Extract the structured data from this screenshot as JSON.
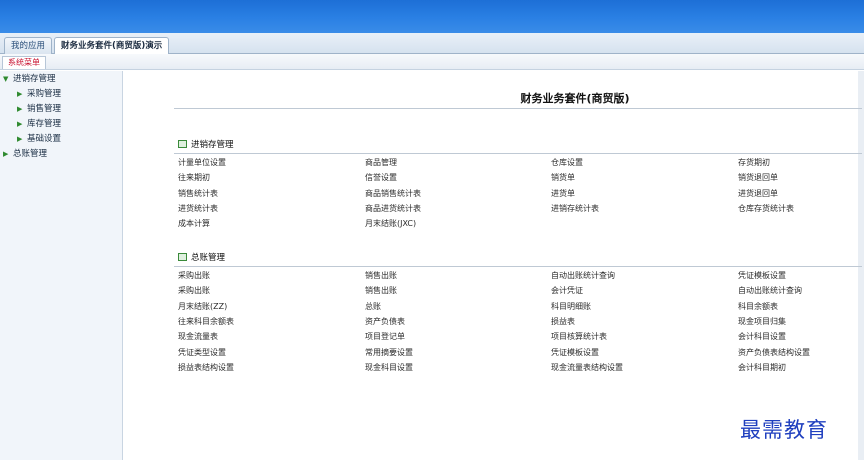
{
  "tabs": [
    {
      "label": "我的应用"
    },
    {
      "label": "财务业务套件(商贸版)演示"
    }
  ],
  "subtab": "系统菜单",
  "sidebar": {
    "items": [
      {
        "label": "进销存管理"
      },
      {
        "label": "采购管理"
      },
      {
        "label": "销售管理"
      },
      {
        "label": "库存管理"
      },
      {
        "label": "基础设置"
      },
      {
        "label": "总账管理"
      }
    ]
  },
  "main": {
    "title": "财务业务套件(商贸版)",
    "sections": [
      {
        "heading": "进销存管理",
        "rows": [
          [
            "计量单位设置",
            "商品管理",
            "仓库设置",
            "存货期初"
          ],
          [
            "往来期初",
            "信誉设置",
            "销货单",
            "销货退回单"
          ],
          [
            "销售统计表",
            "商品销售统计表",
            "进货单",
            "进货退回单"
          ],
          [
            "进货统计表",
            "商品进货统计表",
            "进销存统计表",
            "仓库存货统计表"
          ],
          [
            "成本计算",
            "月末结账(JXC)",
            "",
            ""
          ]
        ]
      },
      {
        "heading": "总账管理",
        "rows": [
          [
            "采购出账",
            "销售出账",
            "自动出账统计查询",
            "凭证模板设置"
          ],
          [
            "采购出账",
            "销售出账",
            "会计凭证",
            "自动出账统计查询"
          ],
          [
            "月末结账(ZZ)",
            "总账",
            "科目明细账",
            "科目余额表"
          ],
          [
            "往来科目余额表",
            "资产负债表",
            "损益表",
            "现金项目归集"
          ],
          [
            "现金流量表",
            "项目登记单",
            "项目核算统计表",
            "会计科目设置"
          ],
          [
            "凭证类型设置",
            "常用摘要设置",
            "凭证模板设置",
            "资产负债表结构设置"
          ],
          [
            "损益表结构设置",
            "现金科目设置",
            "现金流量表结构设置",
            "会计科目期初"
          ]
        ]
      }
    ]
  },
  "watermark": "最需教育",
  "colors": {
    "topbar": "#2a80e4",
    "subtab_text": "#c8102e",
    "watermark": "#1f3fbf"
  }
}
